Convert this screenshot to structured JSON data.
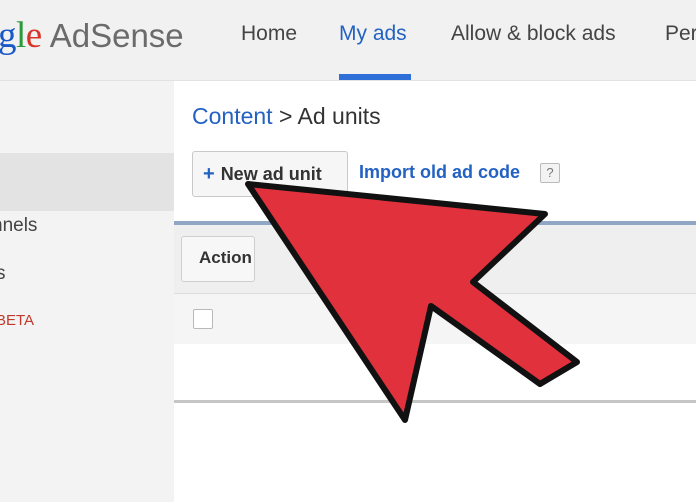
{
  "header": {
    "logo_partial": [
      "g",
      "l",
      "e"
    ],
    "logo_product": "AdSense",
    "nav": {
      "home": "Home",
      "my_ads": "My ads",
      "allow_block": "Allow & block ads",
      "performance_partial": "Per"
    },
    "active_tab": "My ads"
  },
  "sidebar": {
    "items": [
      {
        "label": "nnels"
      },
      {
        "label": "s"
      },
      {
        "label": "BETA"
      }
    ]
  },
  "main": {
    "breadcrumb": {
      "link": "Content",
      "separator": ">",
      "current": "Ad units"
    },
    "new_ad_unit_label": "New ad unit",
    "new_ad_unit_icon": "+",
    "import_label": "Import old ad code",
    "help_glyph": "?",
    "action_label": "Action"
  },
  "overlay": {
    "arrow_color": "#e0313d",
    "arrow_outline": "#111111"
  },
  "colors": {
    "link_blue": "#2362c2",
    "nav_underline": "#2e6fd8",
    "beta_red": "#c0392b"
  }
}
